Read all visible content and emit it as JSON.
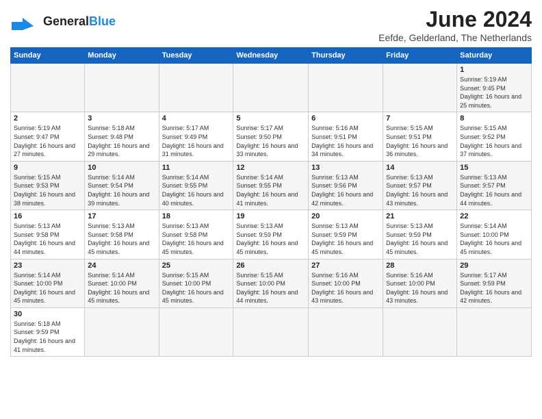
{
  "header": {
    "logo_general": "General",
    "logo_blue": "Blue",
    "title": "June 2024",
    "subtitle": "Eefde, Gelderland, The Netherlands"
  },
  "calendar": {
    "days_of_week": [
      "Sunday",
      "Monday",
      "Tuesday",
      "Wednesday",
      "Thursday",
      "Friday",
      "Saturday"
    ],
    "weeks": [
      [
        {
          "day": "",
          "info": ""
        },
        {
          "day": "",
          "info": ""
        },
        {
          "day": "",
          "info": ""
        },
        {
          "day": "",
          "info": ""
        },
        {
          "day": "",
          "info": ""
        },
        {
          "day": "",
          "info": ""
        },
        {
          "day": "1",
          "info": "Sunrise: 5:19 AM\nSunset: 9:45 PM\nDaylight: 16 hours and 25 minutes."
        }
      ],
      [
        {
          "day": "2",
          "info": "Sunrise: 5:19 AM\nSunset: 9:47 PM\nDaylight: 16 hours and 27 minutes."
        },
        {
          "day": "3",
          "info": "Sunrise: 5:18 AM\nSunset: 9:48 PM\nDaylight: 16 hours and 29 minutes."
        },
        {
          "day": "4",
          "info": "Sunrise: 5:17 AM\nSunset: 9:49 PM\nDaylight: 16 hours and 31 minutes."
        },
        {
          "day": "5",
          "info": "Sunrise: 5:17 AM\nSunset: 9:50 PM\nDaylight: 16 hours and 33 minutes."
        },
        {
          "day": "6",
          "info": "Sunrise: 5:16 AM\nSunset: 9:51 PM\nDaylight: 16 hours and 34 minutes."
        },
        {
          "day": "7",
          "info": "Sunrise: 5:15 AM\nSunset: 9:51 PM\nDaylight: 16 hours and 36 minutes."
        },
        {
          "day": "8",
          "info": "Sunrise: 5:15 AM\nSunset: 9:52 PM\nDaylight: 16 hours and 37 minutes."
        }
      ],
      [
        {
          "day": "9",
          "info": "Sunrise: 5:15 AM\nSunset: 9:53 PM\nDaylight: 16 hours and 38 minutes."
        },
        {
          "day": "10",
          "info": "Sunrise: 5:14 AM\nSunset: 9:54 PM\nDaylight: 16 hours and 39 minutes."
        },
        {
          "day": "11",
          "info": "Sunrise: 5:14 AM\nSunset: 9:55 PM\nDaylight: 16 hours and 40 minutes."
        },
        {
          "day": "12",
          "info": "Sunrise: 5:14 AM\nSunset: 9:55 PM\nDaylight: 16 hours and 41 minutes."
        },
        {
          "day": "13",
          "info": "Sunrise: 5:13 AM\nSunset: 9:56 PM\nDaylight: 16 hours and 42 minutes."
        },
        {
          "day": "14",
          "info": "Sunrise: 5:13 AM\nSunset: 9:57 PM\nDaylight: 16 hours and 43 minutes."
        },
        {
          "day": "15",
          "info": "Sunrise: 5:13 AM\nSunset: 9:57 PM\nDaylight: 16 hours and 44 minutes."
        }
      ],
      [
        {
          "day": "16",
          "info": "Sunrise: 5:13 AM\nSunset: 9:58 PM\nDaylight: 16 hours and 44 minutes."
        },
        {
          "day": "17",
          "info": "Sunrise: 5:13 AM\nSunset: 9:58 PM\nDaylight: 16 hours and 45 minutes."
        },
        {
          "day": "18",
          "info": "Sunrise: 5:13 AM\nSunset: 9:58 PM\nDaylight: 16 hours and 45 minutes."
        },
        {
          "day": "19",
          "info": "Sunrise: 5:13 AM\nSunset: 9:59 PM\nDaylight: 16 hours and 45 minutes."
        },
        {
          "day": "20",
          "info": "Sunrise: 5:13 AM\nSunset: 9:59 PM\nDaylight: 16 hours and 45 minutes."
        },
        {
          "day": "21",
          "info": "Sunrise: 5:13 AM\nSunset: 9:59 PM\nDaylight: 16 hours and 45 minutes."
        },
        {
          "day": "22",
          "info": "Sunrise: 5:14 AM\nSunset: 10:00 PM\nDaylight: 16 hours and 45 minutes."
        }
      ],
      [
        {
          "day": "23",
          "info": "Sunrise: 5:14 AM\nSunset: 10:00 PM\nDaylight: 16 hours and 45 minutes."
        },
        {
          "day": "24",
          "info": "Sunrise: 5:14 AM\nSunset: 10:00 PM\nDaylight: 16 hours and 45 minutes."
        },
        {
          "day": "25",
          "info": "Sunrise: 5:15 AM\nSunset: 10:00 PM\nDaylight: 16 hours and 45 minutes."
        },
        {
          "day": "26",
          "info": "Sunrise: 5:15 AM\nSunset: 10:00 PM\nDaylight: 16 hours and 44 minutes."
        },
        {
          "day": "27",
          "info": "Sunrise: 5:16 AM\nSunset: 10:00 PM\nDaylight: 16 hours and 43 minutes."
        },
        {
          "day": "28",
          "info": "Sunrise: 5:16 AM\nSunset: 10:00 PM\nDaylight: 16 hours and 43 minutes."
        },
        {
          "day": "29",
          "info": "Sunrise: 5:17 AM\nSunset: 9:59 PM\nDaylight: 16 hours and 42 minutes."
        }
      ],
      [
        {
          "day": "30",
          "info": "Sunrise: 5:18 AM\nSunset: 9:59 PM\nDaylight: 16 hours and 41 minutes."
        },
        {
          "day": "",
          "info": ""
        },
        {
          "day": "",
          "info": ""
        },
        {
          "day": "",
          "info": ""
        },
        {
          "day": "",
          "info": ""
        },
        {
          "day": "",
          "info": ""
        },
        {
          "day": "",
          "info": ""
        }
      ]
    ]
  }
}
